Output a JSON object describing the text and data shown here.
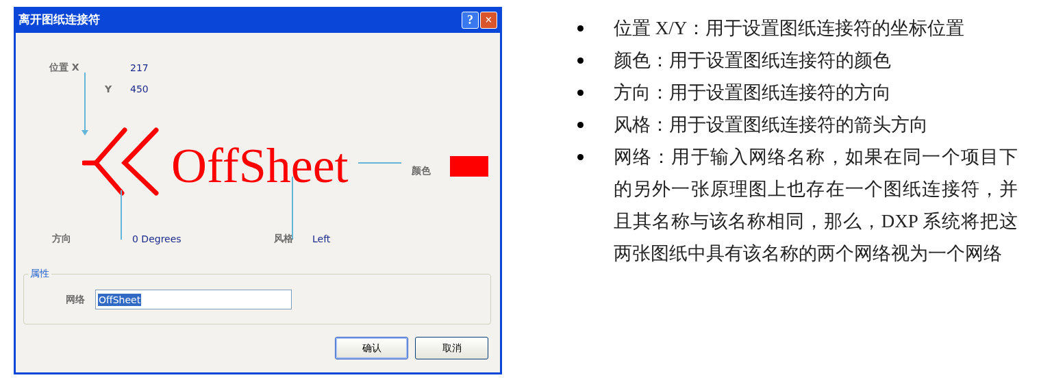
{
  "dialog": {
    "title": "离开图纸连接符",
    "title_buttons": [
      "?",
      "×"
    ],
    "preview": {
      "position_label": "位置 X",
      "x_value": "217",
      "y_label": "Y",
      "y_value": "450",
      "connector_text": "OffSheet",
      "color_label": "颜色",
      "color": "#ff0000",
      "orientation_label": "方向",
      "orientation_value": "0 Degrees",
      "style_label": "风格",
      "style_value": "Left"
    },
    "properties": {
      "legend": "属性",
      "net_label": "网络",
      "net_value": "OffSheet",
      "net_selected": true
    },
    "buttons": [
      {
        "label": "确认",
        "default": true
      },
      {
        "label": "取消",
        "default": false
      }
    ]
  },
  "bullets": [
    "位置 X/Y：用于设置图纸连接符的坐标位置",
    "颜色：用于设置图纸连接符的颜色",
    "方向：用于设置图纸连接符的方向",
    "风格：用于设置图纸连接符的箭头方向",
    "网络：用于输入网络名称，如果在同一个项目下的另外一张原理图上也存在一个图纸连接符，并且其名称与该名称相同，那么，DXP 系统将把这两张图纸中具有该名称的两个网络视为一个网络"
  ]
}
